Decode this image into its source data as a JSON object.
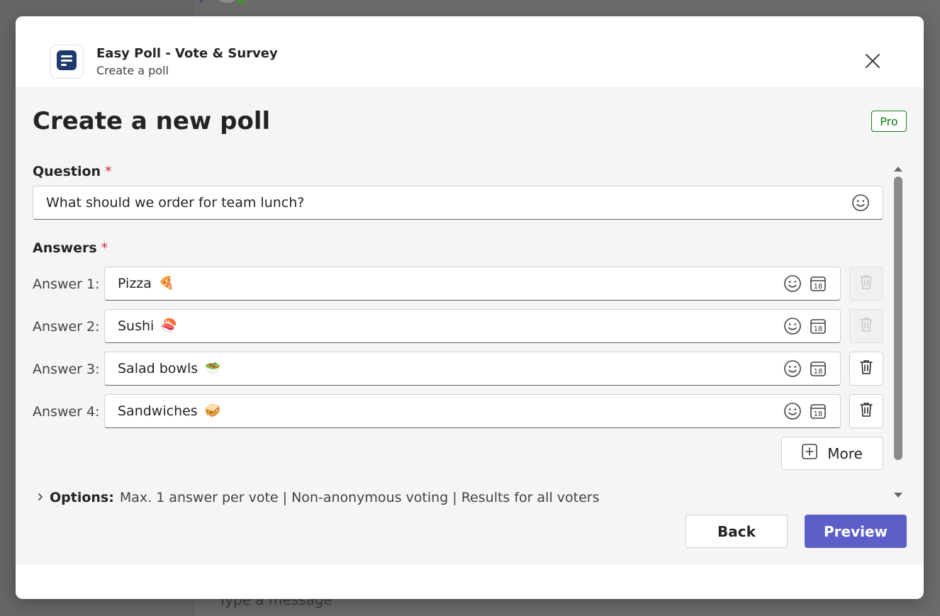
{
  "background": {
    "compose_placeholder": "Type a message"
  },
  "header": {
    "app_name": "Easy Poll - Vote & Survey",
    "subtitle": "Create a poll",
    "app_icon": "list-document-icon",
    "close_icon": "close-icon"
  },
  "page": {
    "title": "Create a new poll",
    "badge": "Pro"
  },
  "question": {
    "label": "Question",
    "required_marker": "*",
    "value": "What should we order for team lunch?",
    "emoji_icon": "emoji-smile-icon"
  },
  "answers": {
    "label": "Answers",
    "required_marker": "*",
    "items": [
      {
        "label": "Answer 1:",
        "value": "Pizza",
        "emoji": "🍕",
        "delete_enabled": false
      },
      {
        "label": "Answer 2:",
        "value": "Sushi",
        "emoji": "🍣",
        "delete_enabled": false
      },
      {
        "label": "Answer 3:",
        "value": "Salad bowls",
        "emoji": "🥗",
        "delete_enabled": true
      },
      {
        "label": "Answer 4:",
        "value": "Sandwiches",
        "emoji": "🥪",
        "delete_enabled": true
      }
    ],
    "calendar_day": "18",
    "more_label": "More"
  },
  "options": {
    "title": "Options:",
    "summary": "Max. 1 answer per vote | Non-anonymous voting | Results for all voters"
  },
  "footer": {
    "back_label": "Back",
    "preview_label": "Preview"
  },
  "colors": {
    "accent": "#5b5fc7",
    "pro_green": "#107c10",
    "required_red": "#c4314b",
    "app_icon_navy": "#1f3a6e"
  }
}
